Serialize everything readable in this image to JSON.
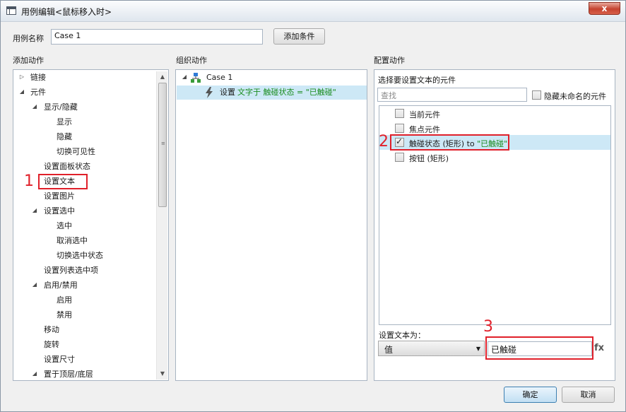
{
  "window": {
    "title": "用例编辑<鼠标移入时>",
    "close_label": "x"
  },
  "case_name": {
    "label": "用例名称",
    "value": "Case 1",
    "add_condition": "添加条件"
  },
  "sections": {
    "add_action": "添加动作",
    "organize_action": "组织动作",
    "configure_action": "配置动作"
  },
  "action_tree": [
    {
      "label": "链接",
      "caret": "▷"
    },
    {
      "label": "元件",
      "caret": "◢"
    },
    {
      "label": "显示/隐藏",
      "caret": "◢"
    },
    {
      "label": "显示"
    },
    {
      "label": "隐藏"
    },
    {
      "label": "切换可见性"
    },
    {
      "label": "设置面板状态"
    },
    {
      "label": "设置文本"
    },
    {
      "label": "设置图片"
    },
    {
      "label": "设置选中",
      "caret": "◢"
    },
    {
      "label": "选中"
    },
    {
      "label": "取消选中"
    },
    {
      "label": "切换选中状态"
    },
    {
      "label": "设置列表选中项"
    },
    {
      "label": "启用/禁用",
      "caret": "◢"
    },
    {
      "label": "启用"
    },
    {
      "label": "禁用"
    },
    {
      "label": "移动"
    },
    {
      "label": "旋转"
    },
    {
      "label": "设置尺寸"
    },
    {
      "label": "置于顶层/底层",
      "caret": "◢"
    }
  ],
  "organize": {
    "case_label": "Case 1",
    "action_prefix": "设置",
    "action_detail": "文字于 触碰状态 = \"已触碰\""
  },
  "configure": {
    "select_label": "选择要设置文本的元件",
    "search_placeholder": "查找",
    "hide_unnamed_label": "隐藏未命名的元件",
    "widgets": [
      {
        "label": "当前元件",
        "checked": false
      },
      {
        "label": "焦点元件",
        "checked": false
      },
      {
        "label": "触碰状态 (矩形) to ",
        "value": "\"已触碰\"",
        "checked": true
      },
      {
        "label": "按钮 (矩形)",
        "checked": false
      }
    ],
    "set_text_label": "设置文本为：",
    "dropdown_value": "值",
    "text_value": "已触碰",
    "fx_label": "fx"
  },
  "annotations": [
    "1",
    "2",
    "3"
  ],
  "footer": {
    "ok": "确定",
    "cancel": "取消"
  }
}
